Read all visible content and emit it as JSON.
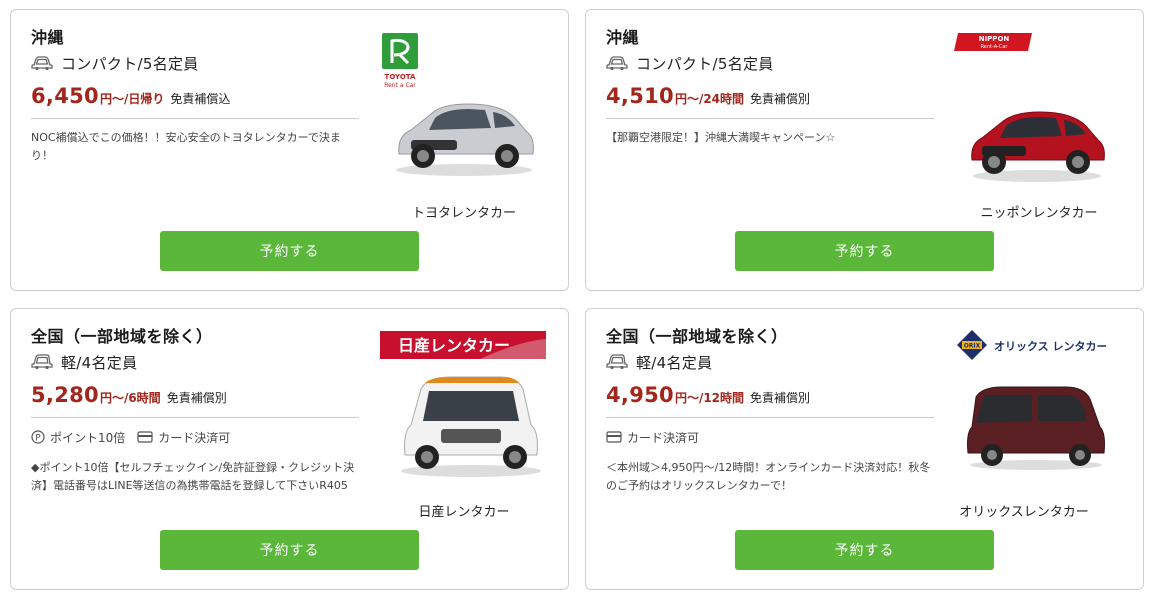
{
  "cards": [
    {
      "region": "沖縄",
      "car_class": "コンパクト/5名定員",
      "price": "6,450",
      "price_unit": "円〜",
      "duration": "/日帰り",
      "insurance": "免責補償込",
      "features": [],
      "description": "NOC補償込でこの価格！！安心安全のトヨタレンタカーで決まり！",
      "company": "トヨタレンタカー",
      "logo": {
        "line1": "TOYOTA",
        "line2": "Rent a Car"
      },
      "car_color": "#c9cdd1",
      "button_label": "予約する"
    },
    {
      "region": "沖縄",
      "car_class": "コンパクト/5名定員",
      "price": "4,510",
      "price_unit": "円〜",
      "duration": "/24時間",
      "insurance": "免責補償別",
      "features": [],
      "description": "【那覇空港限定！】沖縄大満喫キャンペーン☆",
      "company": "ニッポンレンタカー",
      "logo": {
        "line1": "NIPPON",
        "line2": "Rent-A-Car"
      },
      "car_color": "#b3121e",
      "button_label": "予約する"
    },
    {
      "region": "全国（一部地域を除く）",
      "car_class": "軽/4名定員",
      "price": "5,280",
      "price_unit": "円〜",
      "duration": "/6時間",
      "insurance": "免責補償別",
      "features": [
        "ポイント10倍",
        "カード決済可"
      ],
      "description": "◆ポイント10倍【セルフチェックイン/免許証登録・クレジット決済】電話番号はLINE等送信の為携帯電話を登録して下さいR405",
      "company": "日産レンタカー",
      "logo": {
        "line1": "日産レンタカー"
      },
      "car_color": "#eeeeee",
      "button_label": "予約する"
    },
    {
      "region": "全国（一部地域を除く）",
      "car_class": "軽/4名定員",
      "price": "4,950",
      "price_unit": "円〜",
      "duration": "/12時間",
      "insurance": "免責補償別",
      "features": [
        "カード決済可"
      ],
      "description": "＜本州域＞4,950円〜/12時間！オンラインカード決済対応！秋冬のご予約はオリックスレンタカーで！",
      "company": "オリックスレンタカー",
      "logo": {
        "line1": "ORIX",
        "line2": "オリックス レンタカー"
      },
      "car_color": "#5a1f22",
      "button_label": "予約する"
    }
  ]
}
